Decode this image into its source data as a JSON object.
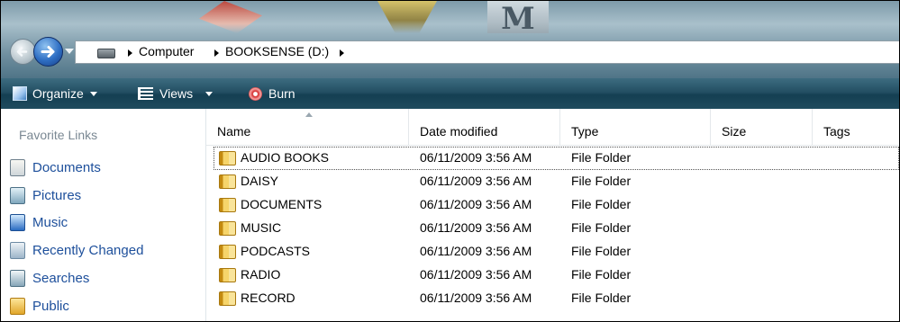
{
  "address_bar": {
    "crumbs": [
      "Computer",
      "BOOKSENSE (D:)"
    ]
  },
  "toolbar": {
    "organize": "Organize",
    "views": "Views",
    "burn": "Burn"
  },
  "nav_pane": {
    "title": "Favorite Links",
    "links": [
      {
        "label": "Documents",
        "icon": "documents-icon"
      },
      {
        "label": "Pictures",
        "icon": "pictures-icon"
      },
      {
        "label": "Music",
        "icon": "music-icon"
      },
      {
        "label": "Recently Changed",
        "icon": "recently-changed-icon"
      },
      {
        "label": "Searches",
        "icon": "searches-icon"
      },
      {
        "label": "Public",
        "icon": "public-folder-icon"
      }
    ]
  },
  "file_list": {
    "columns": [
      "Name",
      "Date modified",
      "Type",
      "Size",
      "Tags"
    ],
    "rows": [
      {
        "name": "AUDIO BOOKS",
        "date": "06/11/2009 3:56 AM",
        "type": "File Folder",
        "size": "",
        "tags": ""
      },
      {
        "name": "DAISY",
        "date": "06/11/2009 3:56 AM",
        "type": "File Folder",
        "size": "",
        "tags": ""
      },
      {
        "name": "DOCUMENTS",
        "date": "06/11/2009 3:56 AM",
        "type": "File Folder",
        "size": "",
        "tags": ""
      },
      {
        "name": "MUSIC",
        "date": "06/11/2009 3:56 AM",
        "type": "File Folder",
        "size": "",
        "tags": ""
      },
      {
        "name": "PODCASTS",
        "date": "06/11/2009 3:56 AM",
        "type": "File Folder",
        "size": "",
        "tags": ""
      },
      {
        "name": "RADIO",
        "date": "06/11/2009 3:56 AM",
        "type": "File Folder",
        "size": "",
        "tags": ""
      },
      {
        "name": "RECORD",
        "date": "06/11/2009 3:56 AM",
        "type": "File Folder",
        "size": "",
        "tags": ""
      }
    ]
  },
  "colors": {
    "toolbar": "#1f4b5e",
    "link": "#1d4f9b",
    "nav_title": "#7a8893",
    "folder": "#f6d46a"
  }
}
